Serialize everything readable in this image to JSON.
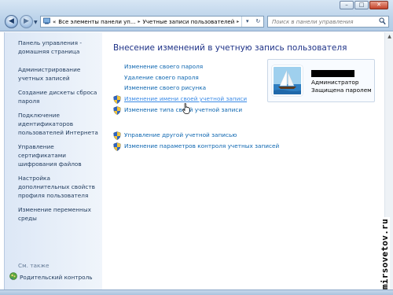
{
  "window": {
    "minimize_glyph": "–",
    "maximize_glyph": "□",
    "close_glyph": "✕"
  },
  "address": {
    "overflow_glyph": "«",
    "crumbs": [
      "Все элементы панели уп...",
      "Учетные записи пользователей"
    ],
    "separator": "▸"
  },
  "search": {
    "placeholder": "Поиск в панели управления"
  },
  "sidebar": {
    "home": "Панель управления - домашняя страница",
    "links": [
      "Администрирование учетных записей",
      "Создание дискеты сброса пароля",
      "Подключение идентификаторов пользователей Интернета",
      "Управление сертификатами шифрования файлов",
      "Настройка дополнительных свойств профиля пользователя",
      "Изменение переменных среды"
    ],
    "see_also_label": "См. также",
    "parental_control": "Родительский контроль"
  },
  "main": {
    "heading": "Внесение изменений в учетную запись пользователя",
    "tasks": [
      "Изменение своего пароля",
      "Удаление своего пароля",
      "Изменение своего рисунка",
      "Изменение имени своей учетной записи",
      "Изменение типа своей учетной записи"
    ],
    "other_tasks": [
      "Управление другой учетной записью",
      "Изменение параметров контроля учетных записей"
    ]
  },
  "user": {
    "role": "Администратор",
    "status": "Защищена паролем"
  },
  "watermark": "mirsovetov.ru",
  "icons": {
    "shield": "uac-shield-icon",
    "parental": "parental-control-icon",
    "avatar": "sailboat-avatar"
  },
  "colors": {
    "link": "#0d66b0",
    "heading": "#1e3287",
    "sidebar_bg": "#dce7f6"
  }
}
